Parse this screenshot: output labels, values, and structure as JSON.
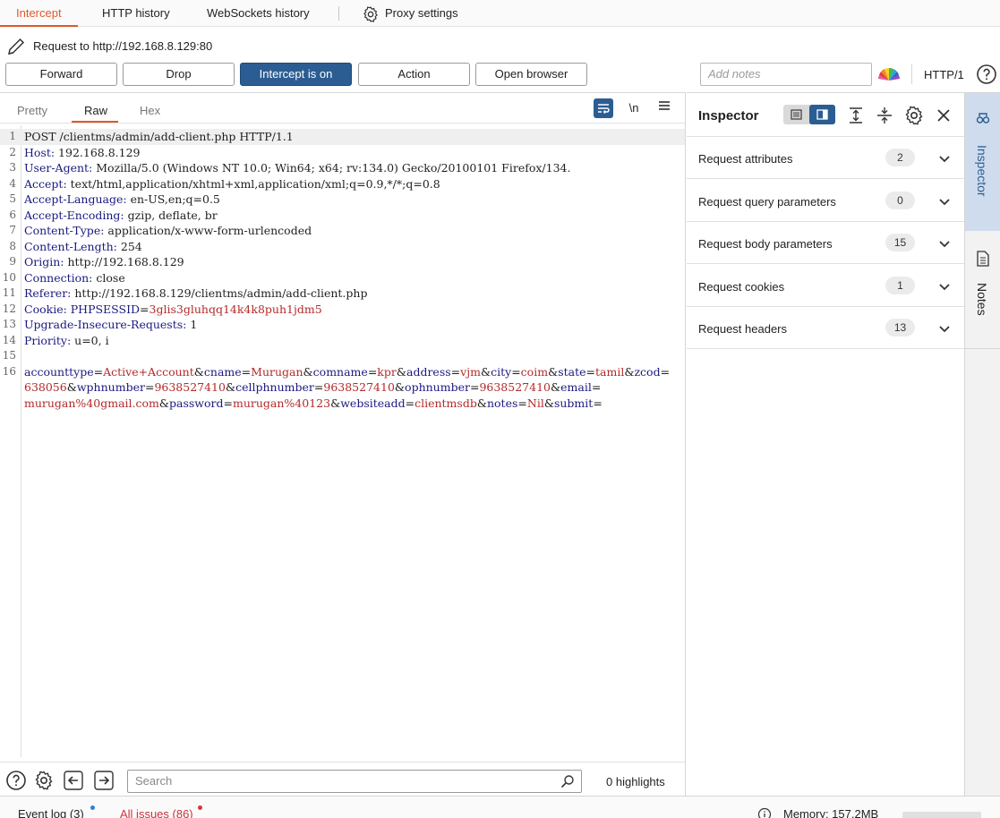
{
  "top_tabs": {
    "intercept": "Intercept",
    "http_history": "HTTP history",
    "websockets_history": "WebSockets history",
    "proxy_settings": "Proxy settings"
  },
  "request_target": "Request to http://192.168.8.129:80",
  "toolbar": {
    "forward": "Forward",
    "drop": "Drop",
    "intercept": "Intercept is on",
    "action": "Action",
    "open_browser": "Open browser",
    "notes_placeholder": "Add notes",
    "http_version": "HTTP/1"
  },
  "editor": {
    "tabs": [
      "Pretty",
      "Raw",
      "Hex"
    ],
    "active_tab": "Raw",
    "newline_toggle": "\\n",
    "lines": [
      {
        "n": "1",
        "text": "POST /clientms/admin/add-client.php HTTP/1.1"
      },
      {
        "n": "2",
        "key": "Host:",
        "val": " 192.168.8.129"
      },
      {
        "n": "3",
        "key": "User-Agent:",
        "val": " Mozilla/5.0 (Windows NT 10.0; Win64; x64; rv:134.0) Gecko/20100101 Firefox/134."
      },
      {
        "n": "4",
        "key": "Accept:",
        "val": " text/html,application/xhtml+xml,application/xml;q=0.9,*/*;q=0.8"
      },
      {
        "n": "5",
        "key": "Accept-Language:",
        "val": " en-US,en;q=0.5"
      },
      {
        "n": "6",
        "key": "Accept-Encoding:",
        "val": " gzip, deflate, br"
      },
      {
        "n": "7",
        "key": "Content-Type:",
        "val": " application/x-www-form-urlencoded"
      },
      {
        "n": "8",
        "key": "Content-Length:",
        "val": " 254"
      },
      {
        "n": "9",
        "key": "Origin:",
        "val": " http://192.168.8.129"
      },
      {
        "n": "10",
        "key": "Connection:",
        "val": " close"
      },
      {
        "n": "11",
        "key": "Referer:",
        "val": " http://192.168.8.129/clientms/admin/add-client.php"
      },
      {
        "n": "12",
        "key": "Cookie:",
        "ckey": " PHPSESSID",
        "cval": "3glis3gluhqq14k4k8puh1jdm5"
      },
      {
        "n": "13",
        "key": "Upgrade-Insecure-Requests:",
        "val": " 1"
      },
      {
        "n": "14",
        "key": "Priority:",
        "val": " u=0, i"
      },
      {
        "n": "15",
        "text": ""
      },
      {
        "n": "16",
        "body": [
          [
            "accounttype",
            "Active+Account"
          ],
          [
            "cname",
            "Murugan"
          ],
          [
            "comname",
            "kpr"
          ],
          [
            "address",
            "vjm"
          ],
          [
            "city",
            "coim"
          ],
          [
            "state",
            "tamil"
          ],
          [
            "zcod",
            ""
          ]
        ]
      }
    ],
    "body_wrap_1": [
      [
        "",
        "638056"
      ],
      [
        "wphnumber",
        "9638527410"
      ],
      [
        "cellphnumber",
        "9638527410"
      ],
      [
        "ophnumber",
        "9638527410"
      ],
      [
        "email",
        ""
      ]
    ],
    "body_wrap_2": [
      [
        "",
        "murugan%40gmail.com"
      ],
      [
        "password",
        "murugan%40123"
      ],
      [
        "websiteadd",
        "clientmsdb"
      ],
      [
        "notes",
        "Nil"
      ],
      [
        "submit",
        ""
      ]
    ],
    "search_placeholder": "Search",
    "highlights": "0 highlights"
  },
  "inspector": {
    "title": "Inspector",
    "sections": [
      {
        "label": "Request attributes",
        "count": "2"
      },
      {
        "label": "Request query parameters",
        "count": "0"
      },
      {
        "label": "Request body parameters",
        "count": "15"
      },
      {
        "label": "Request cookies",
        "count": "1"
      },
      {
        "label": "Request headers",
        "count": "13"
      }
    ]
  },
  "side_tabs": {
    "inspector": "Inspector",
    "notes": "Notes"
  },
  "status": {
    "event_log": "Event log (3)",
    "all_issues": "All issues (86)",
    "memory": "Memory: 157.2MB"
  },
  "colors": {
    "accent": "#e2592b",
    "primary_blue": "#2b5d93",
    "header_key": "#1a1a80",
    "param_value": "#b32a2a",
    "event_dot": "#2f7fd6",
    "issue_dot": "#d9343b"
  }
}
